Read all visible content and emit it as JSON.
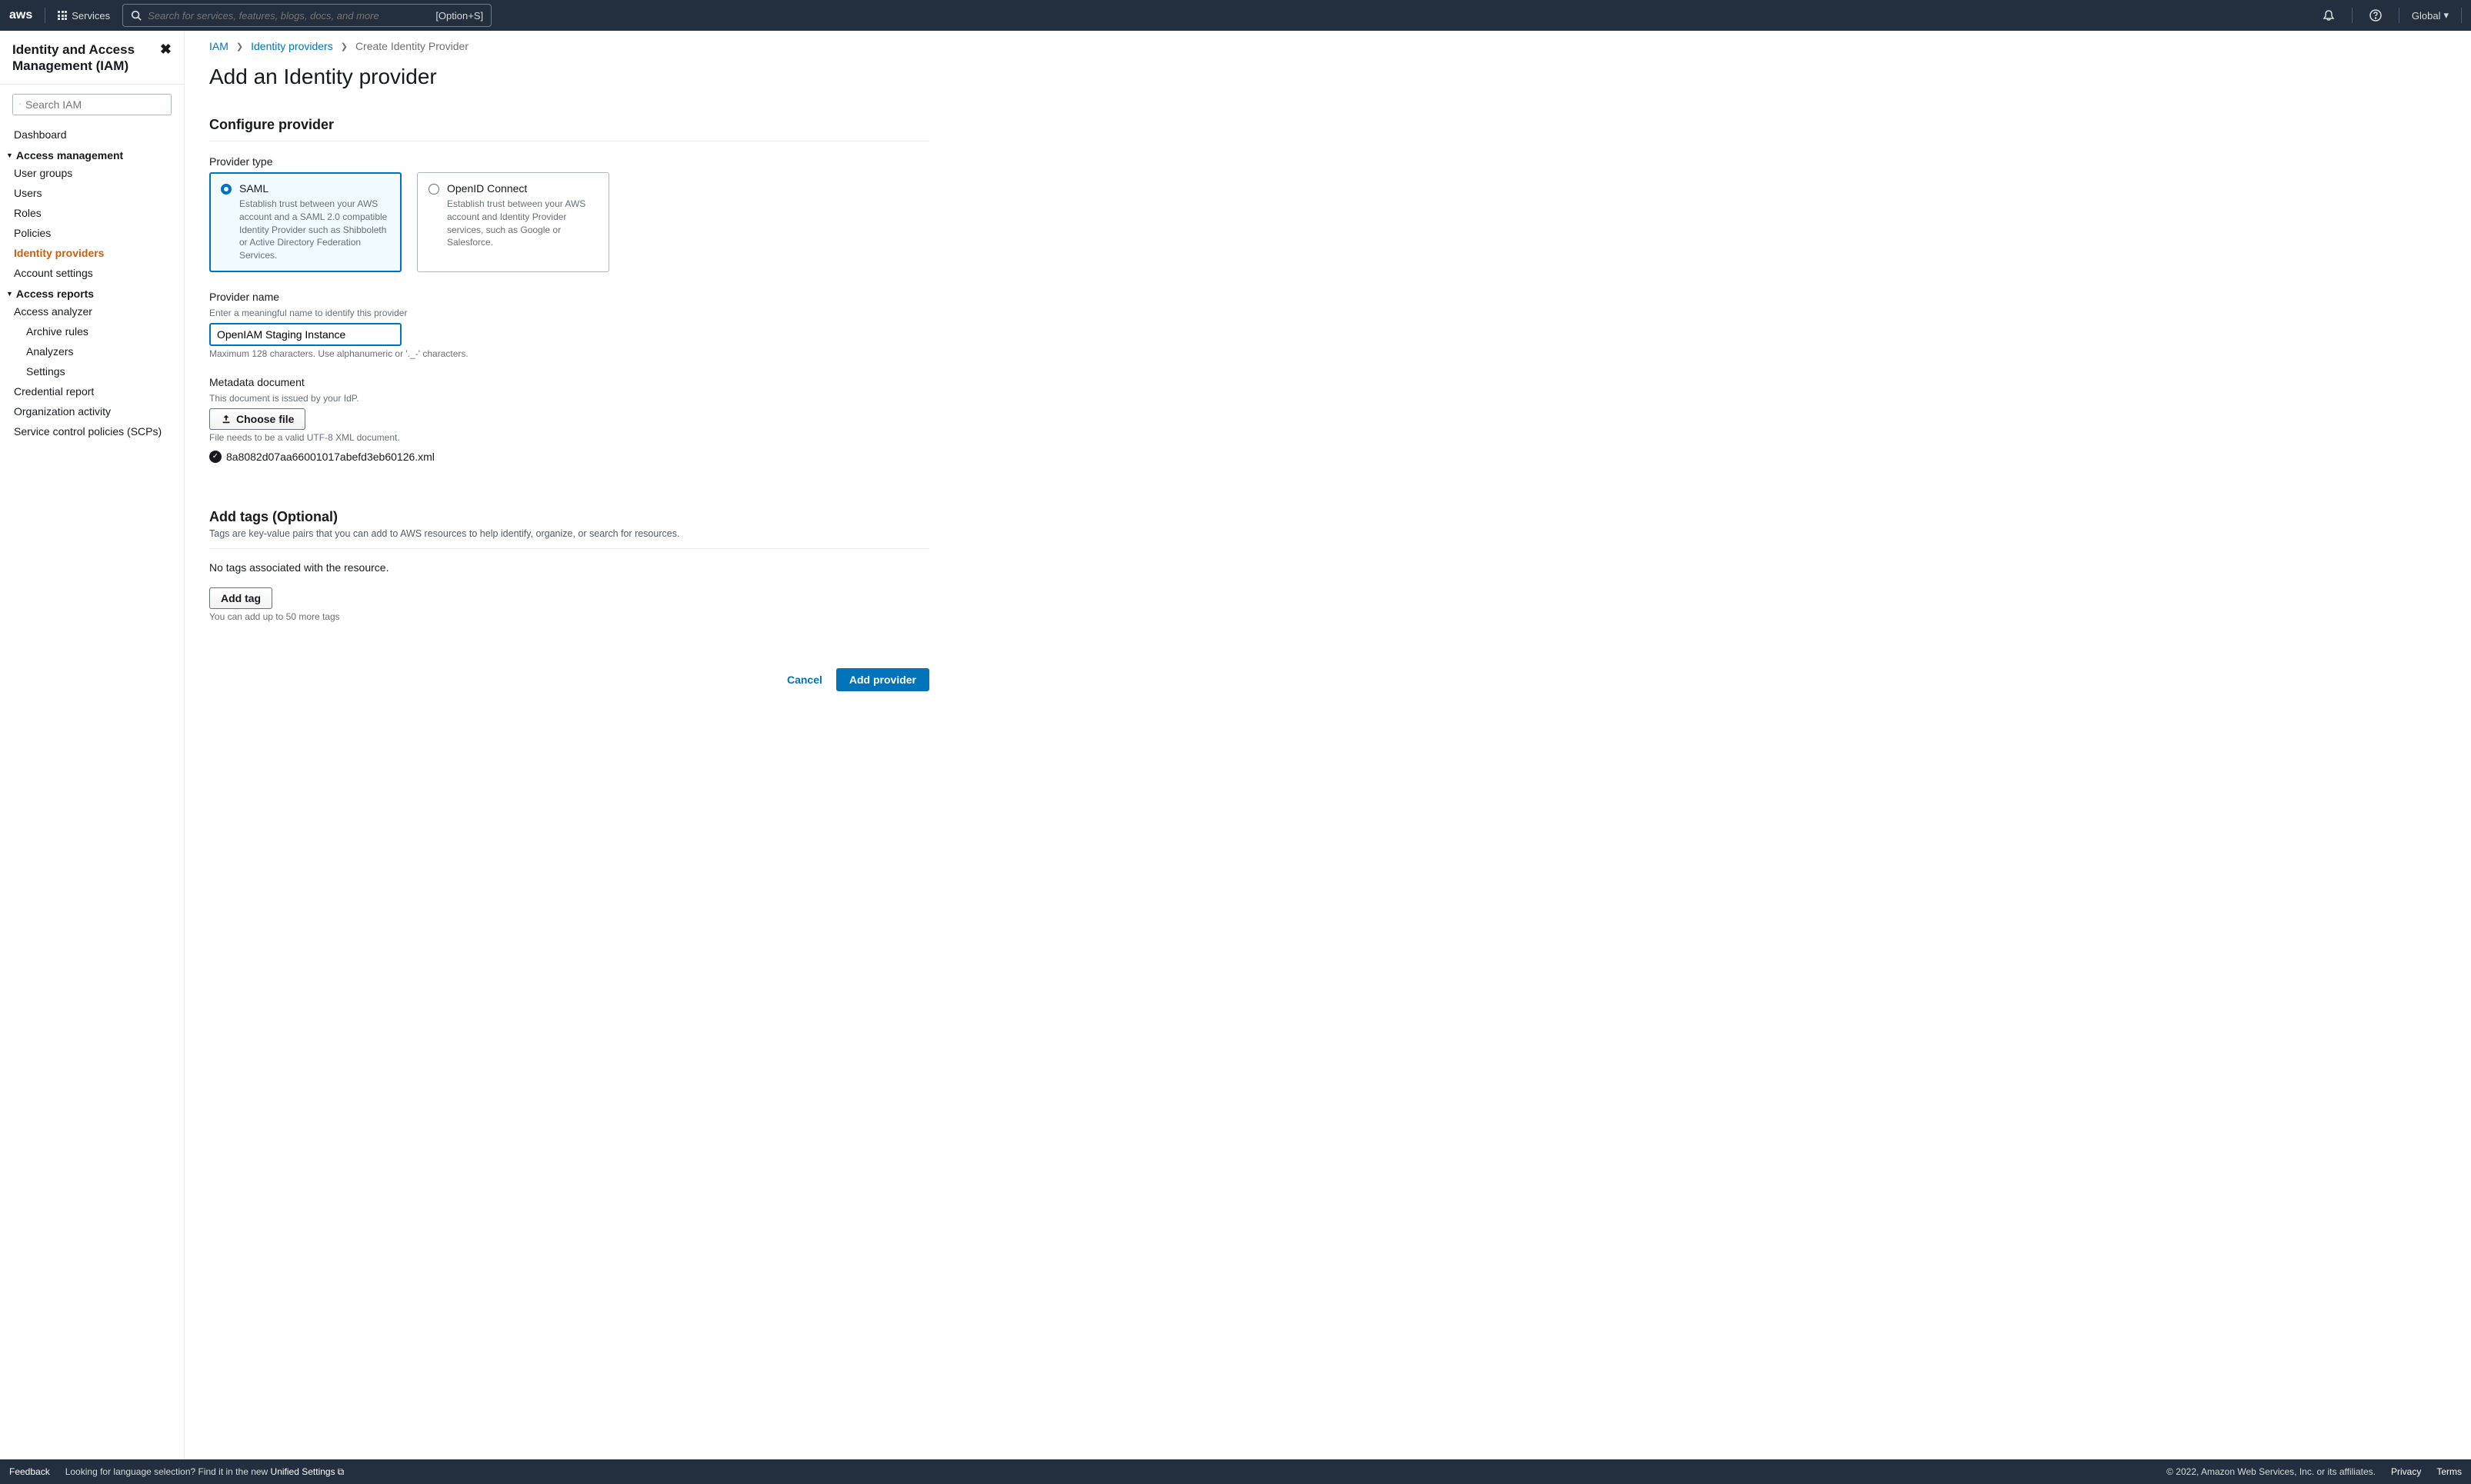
{
  "topnav": {
    "logo": "aws",
    "services": "Services",
    "search_placeholder": "Search for services, features, blogs, docs, and more",
    "search_kbd": "[Option+S]",
    "region": "Global"
  },
  "sidebar": {
    "title": "Identity and Access Management (IAM)",
    "search_placeholder": "Search IAM",
    "dashboard": "Dashboard",
    "access_mgmt_header": "Access management",
    "access_mgmt": {
      "user_groups": "User groups",
      "users": "Users",
      "roles": "Roles",
      "policies": "Policies",
      "identity_providers": "Identity providers",
      "account_settings": "Account settings"
    },
    "access_reports_header": "Access reports",
    "access_reports": {
      "access_analyzer": "Access analyzer",
      "archive_rules": "Archive rules",
      "analyzers": "Analyzers",
      "settings": "Settings",
      "credential_report": "Credential report",
      "organization_activity": "Organization activity",
      "scps": "Service control policies (SCPs)"
    }
  },
  "breadcrumb": {
    "iam": "IAM",
    "idp": "Identity providers",
    "current": "Create Identity Provider"
  },
  "page": {
    "title": "Add an Identity provider",
    "configure_header": "Configure provider",
    "provider_type_label": "Provider type",
    "saml": {
      "title": "SAML",
      "desc": "Establish trust between your AWS account and a SAML 2.0 compatible Identity Provider such as Shibboleth or Active Directory Federation Services."
    },
    "oidc": {
      "title": "OpenID Connect",
      "desc": "Establish trust between your AWS account and Identity Provider services, such as Google or Salesforce."
    },
    "provider_name": {
      "label": "Provider name",
      "hint_above": "Enter a meaningful name to identify this provider",
      "value": "OpenIAM Staging Instance",
      "hint_below": "Maximum 128 characters. Use alphanumeric or '._-' characters."
    },
    "metadata": {
      "label": "Metadata document",
      "hint_above": "This document is issued by your IdP.",
      "choose_file": "Choose file",
      "hint_below": "File needs to be a valid UTF-8 XML document.",
      "filename": "8a8082d07aa66001017abefd3eb60126.xml"
    },
    "tags": {
      "header": "Add tags (Optional)",
      "desc": "Tags are key-value pairs that you can add to AWS resources to help identify, organize, or search for resources.",
      "empty": "No tags associated with the resource.",
      "add_tag": "Add tag",
      "limit": "You can add up to 50 more tags"
    },
    "actions": {
      "cancel": "Cancel",
      "add_provider": "Add provider"
    }
  },
  "footer": {
    "feedback": "Feedback",
    "lang_prompt": "Looking for language selection? Find it in the new ",
    "unified": "Unified Settings",
    "copyright": "© 2022, Amazon Web Services, Inc. or its affiliates.",
    "privacy": "Privacy",
    "terms": "Terms"
  }
}
